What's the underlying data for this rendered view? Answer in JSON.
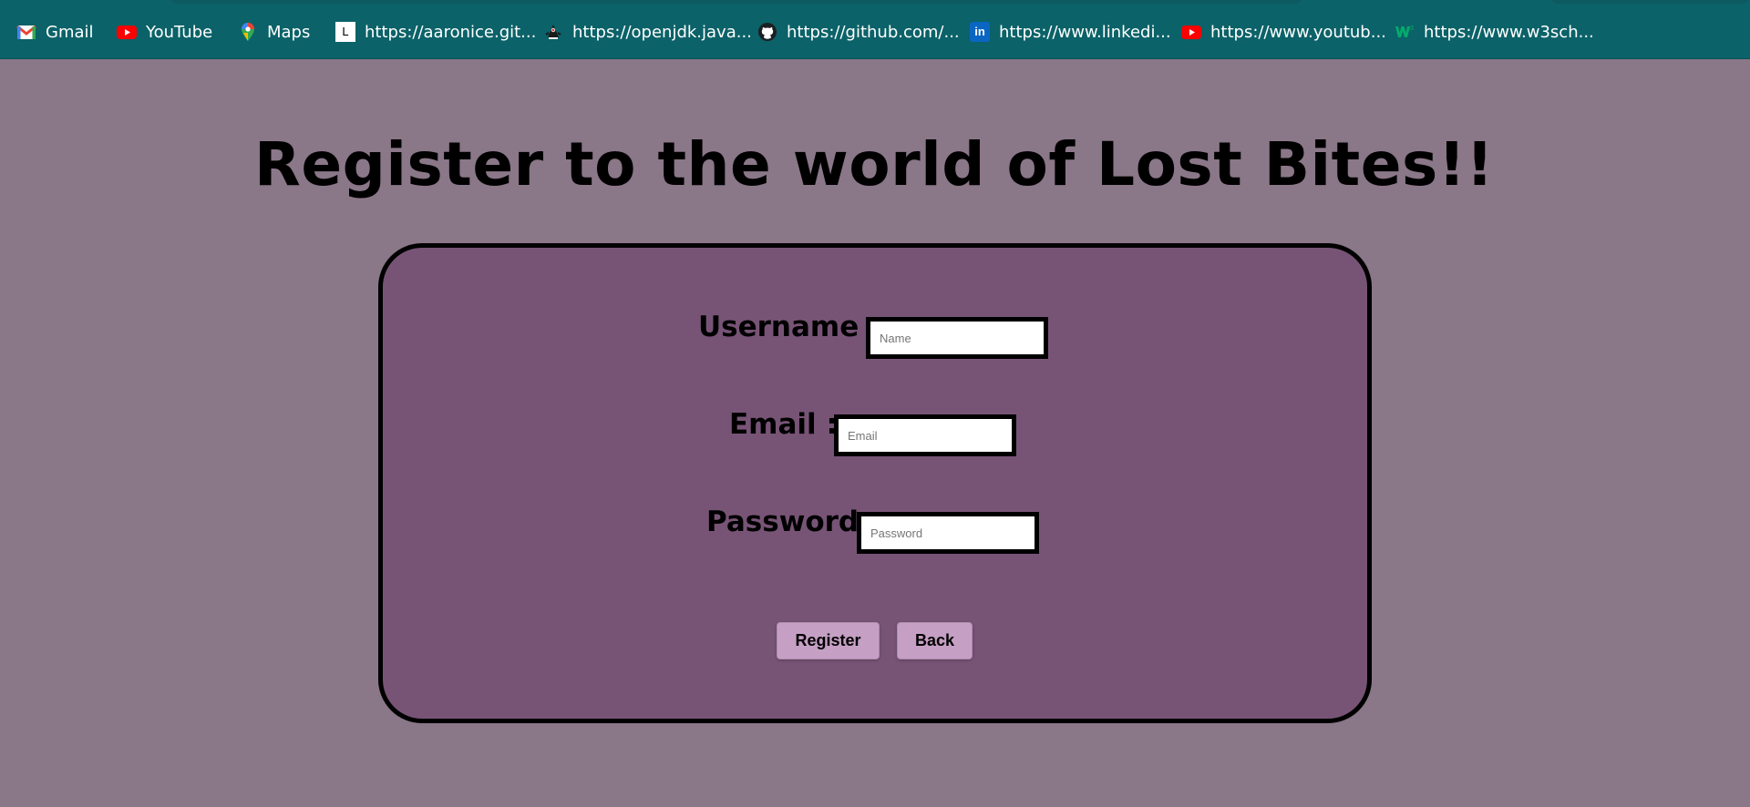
{
  "bookmarks": [
    {
      "label": "Gmail",
      "icon": "gmail-icon"
    },
    {
      "label": "YouTube",
      "icon": "youtube-icon"
    },
    {
      "label": "Maps",
      "icon": "maps-icon"
    },
    {
      "label": "https://aaronice.git...",
      "icon": "letter-l-icon",
      "icon_text": "L"
    },
    {
      "label": "https://openjdk.java...",
      "icon": "openjdk-duke-icon"
    },
    {
      "label": "https://github.com/...",
      "icon": "github-icon"
    },
    {
      "label": "https://www.linkedi...",
      "icon": "linkedin-icon",
      "icon_text": "in"
    },
    {
      "label": "https://www.youtub...",
      "icon": "youtube-icon"
    },
    {
      "label": "https://www.w3sch...",
      "icon": "w3schools-icon"
    }
  ],
  "page": {
    "title": "Register to the world of Lost Bites!!"
  },
  "form": {
    "username_label": "Username :",
    "username_placeholder": "Name",
    "email_label": "Email :",
    "email_placeholder": "Email",
    "password_label": "Password :",
    "password_placeholder": "Password",
    "register_label": "Register",
    "back_label": "Back"
  },
  "colors": {
    "bookmarks_bar": "#0b6268",
    "page_background": "#8a7788",
    "card_background": "#775476",
    "button_background": "#c59fc4"
  }
}
